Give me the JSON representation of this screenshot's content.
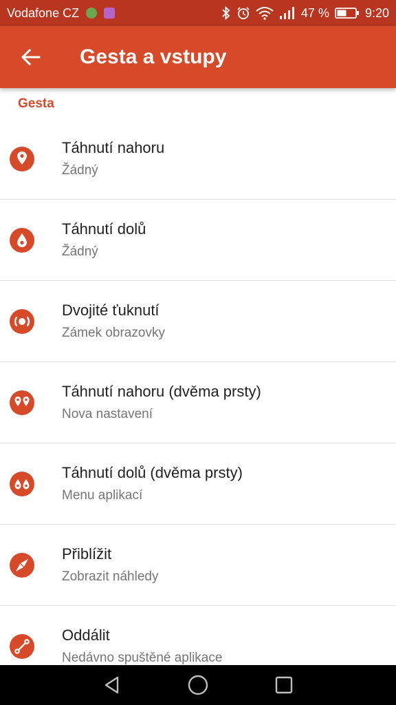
{
  "status_bar": {
    "carrier": "Vodafone CZ",
    "battery_percent": "47 %",
    "time": "9:20",
    "icons": [
      "hangouts-icon",
      "image-icon",
      "bluetooth-icon",
      "alarm-icon",
      "wifi-icon",
      "signal-icon",
      "battery-icon"
    ],
    "colors": {
      "background": "#b8361f",
      "hangouts": "#6aa84f",
      "image": "#b565c9"
    }
  },
  "app_bar": {
    "title": "Gesta a vstupy",
    "back_icon": "arrow-back-icon",
    "color": "#d64a2a"
  },
  "section": {
    "header": "Gesta"
  },
  "items": [
    {
      "title": "Táhnutí nahoru",
      "subtitle": "Žádný",
      "icon": "swipe-up-icon"
    },
    {
      "title": "Táhnutí dolů",
      "subtitle": "Žádný",
      "icon": "swipe-down-icon"
    },
    {
      "title": "Dvojité ťuknutí",
      "subtitle": "Zámek obrazovky",
      "icon": "double-tap-icon"
    },
    {
      "title": "Táhnutí nahoru (dvěma prsty)",
      "subtitle": "Nova nastavení",
      "icon": "two-finger-swipe-up-icon"
    },
    {
      "title": "Táhnutí dolů (dvěma prsty)",
      "subtitle": "Menu aplikací",
      "icon": "two-finger-swipe-down-icon"
    },
    {
      "title": "Přiblížit",
      "subtitle": "Zobrazit náhledy",
      "icon": "pinch-out-icon"
    },
    {
      "title": "Oddálit",
      "subtitle": "Nedávno spuštěné aplikace",
      "icon": "pinch-in-icon"
    }
  ],
  "nav_bar": {
    "buttons": [
      "back-triangle-icon",
      "home-circle-icon",
      "recents-square-icon"
    ]
  }
}
